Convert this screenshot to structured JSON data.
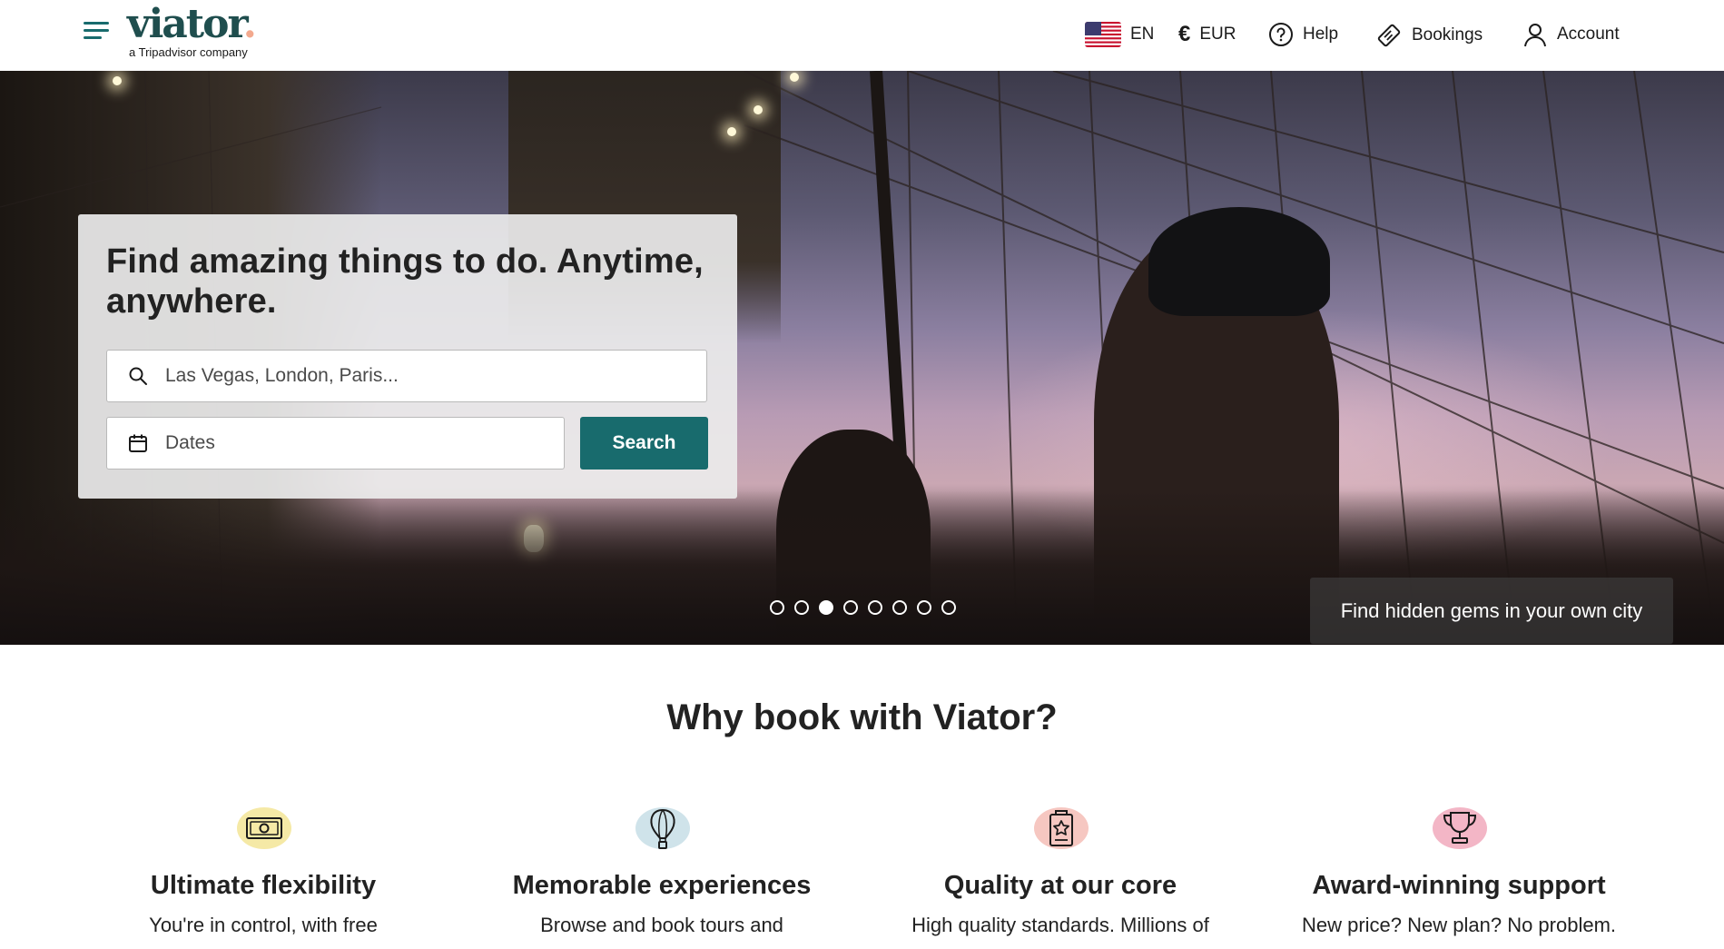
{
  "header": {
    "logo_text": "viator",
    "logo_tagline": "a Tripadvisor company",
    "language": "EN",
    "currency": "EUR",
    "help_label": "Help",
    "bookings_label": "Bookings",
    "account_label": "Account"
  },
  "hero": {
    "headline": "Find amazing things to do. Anytime, anywhere.",
    "search_placeholder": "Las Vegas, London, Paris...",
    "dates_placeholder": "Dates",
    "search_button": "Search",
    "carousel": {
      "total_slides": 8,
      "active_slide": 3
    },
    "caption": "Find hidden gems in your own city"
  },
  "why": {
    "title": "Why book with Viator?",
    "features": [
      {
        "icon": "money-icon",
        "title": "Ultimate flexibility",
        "text": "You're in control, with free",
        "blob_color": "#f5e9a6"
      },
      {
        "icon": "hot-air-balloon-icon",
        "title": "Memorable experiences",
        "text": "Browse and book tours and",
        "blob_color": "#cfe3ea"
      },
      {
        "icon": "certificate-star-icon",
        "title": "Quality at our core",
        "text": "High quality standards. Millions of",
        "blob_color": "#f6c7c1"
      },
      {
        "icon": "trophy-icon",
        "title": "Award-winning support",
        "text": "New price? New plan? No problem.",
        "blob_color": "#f3b6c6"
      }
    ]
  },
  "colors": {
    "brand": "#186b6d",
    "logo": "#1f4e4e"
  }
}
